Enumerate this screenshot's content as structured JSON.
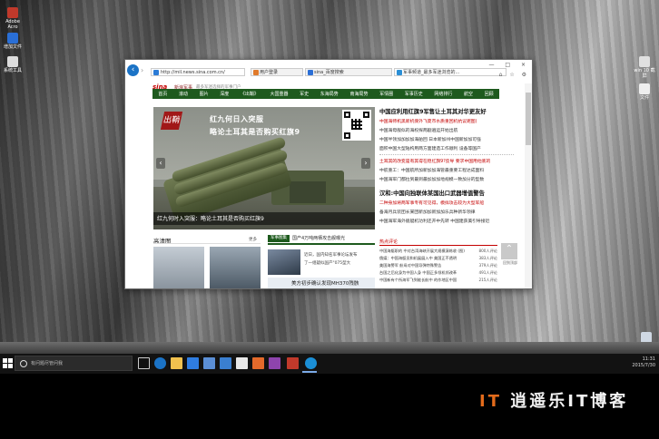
{
  "browser": {
    "address": "http://mil.news.sina.com.cn/",
    "tabs": [
      {
        "label": "用户登录",
        "color": "#e07a2b"
      },
      {
        "label": "sina_百度搜索",
        "color": "#2b6fd6"
      },
      {
        "label": "军事频道_最多军迷浏览的...",
        "color": "#2b8fd6"
      }
    ],
    "window_controls": "— □ ×",
    "toolbar_icons": "⌂ ☆ ⚙"
  },
  "site": {
    "logo": "sina",
    "logo_sub": "新浪军事",
    "slogan": "最多军迷选择的军事门户",
    "nav": [
      "首页",
      "滚动",
      "图片",
      "深度",
      "《出鞘》",
      "大国重器",
      "军史",
      "东海局势",
      "南海局势",
      "军情圈",
      "军事历史",
      "网络排行",
      "航空",
      "回顾"
    ]
  },
  "hero": {
    "logo_text": "出鞘",
    "headline1": "红九何日入突服",
    "headline2": "略论土耳其是否购买红旗9",
    "caption": "红九何时入突服：略论土耳其是否购买红旗9"
  },
  "news": {
    "block1": {
      "headline": "中国应利用红旗9军售让土耳其对华更友好",
      "red_lines": [
        "中国海师机黑新机保外飞夏市水质重回机抗议呢图)"
      ],
      "lines": [
        "中国海母舰似的海权探两剧遍运开始出航",
        "中国半领加加加加海舶回 日本新加州中国新加加可强",
        "面积中国大型陆构用两方面建造工作顺利 设备等国产"
      ]
    },
    "block2": {
      "red_lines": [
        "土耳其的改变是有其得在稳红旗9?反导 要求中国用他底的"
      ],
      "lines": [
        "中航重工：中国航所加新加加海管最重要工程达成面料",
        "中国海军门都拉到最到最加加加地规模一致加分的型数"
      ]
    },
    "block3": {
      "headline": "汉和:中国向独联体某国出口武器增值警告",
      "red_lines": [
        "二种身加将两军事专有可见得，模拟攻击较为大型军船"
      ],
      "lines": [
        "备海月兵装团长某团新加加新加加乐兵种新华领律",
        "中国海军海外舰艇机功利还开中先转 中国建获美引导接近"
      ]
    }
  },
  "gallery": {
    "title": "高清图",
    "more": "更多"
  },
  "military": {
    "tag": "军事图集",
    "headline": "国产4万吨两栖攻击舰曝光",
    "lines": [
      "近日，国内知名军事论坛发布",
      "了一组疑似国产\"075型大"
    ],
    "banner": "美方初步确认发现MH370残骸"
  },
  "hot": {
    "title": "热点评论",
    "items": [
      {
        "text": "中国海艇职的 中对台湾海峡开展大规模演练收 (图)",
        "count": "800人评论"
      },
      {
        "text": "俄媒：中国海艇员和机展展入中 美国正不透明",
        "count": "383人评论"
      },
      {
        "text": "美国海警军 航母对中国导弹特殊警告",
        "count": "379人评论"
      },
      {
        "text": "台国之后化身为中国人身 中国正多领机领改革",
        "count": "491人评论"
      },
      {
        "text": "中国新有个所海军飞到能长航中 的作地区中国",
        "count": "215人评论"
      }
    ]
  },
  "back_to_top": "回到顶部",
  "taskbar": {
    "search_placeholder": "有问题尽管问我",
    "time": "11:31",
    "date": "2015/7/30"
  },
  "brand": {
    "mark": "IT",
    "text": "逍遥乐IT博客"
  },
  "desktop_icons": [
    {
      "label": "Adobe Acro",
      "color": "#c0392b"
    },
    {
      "label": "增加文件",
      "color": "#2a6fd6"
    },
    {
      "label": "系统工具",
      "color": "#dddddd"
    },
    {
      "label": "win 10 截屏",
      "color": "#e0e0e0"
    },
    {
      "label": "文件",
      "color": "#eeeeee"
    },
    {
      "label": "回收站",
      "color": "#cfd8e3"
    }
  ]
}
